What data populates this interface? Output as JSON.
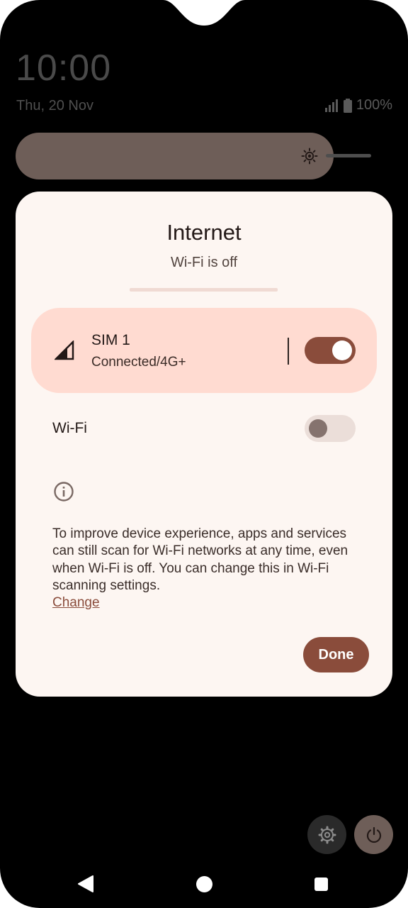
{
  "status_bar": {
    "time": "10:00",
    "date": "Thu, 20 Nov",
    "battery_percent": "100%"
  },
  "quick_settings": {
    "brightness_icon": "brightness-icon",
    "settings_icon": "gear-icon",
    "power_icon": "power-icon"
  },
  "dialog": {
    "title": "Internet",
    "subtitle": "Wi-Fi is off",
    "sim": {
      "name": "SIM 1",
      "status": "Connected/4G+",
      "enabled": true
    },
    "wifi": {
      "label": "Wi-Fi",
      "enabled": false
    },
    "info_text": "To improve device experience, apps and services can still scan for Wi-Fi networks at any time, even when Wi-Fi is off. You can change this in Wi-Fi scanning settings.",
    "info_link": "Change",
    "done_label": "Done"
  },
  "colors": {
    "accent": "#8a4c3b",
    "dialog_bg": "#fdf6f2",
    "sim_card_bg": "#ffdbd1"
  }
}
